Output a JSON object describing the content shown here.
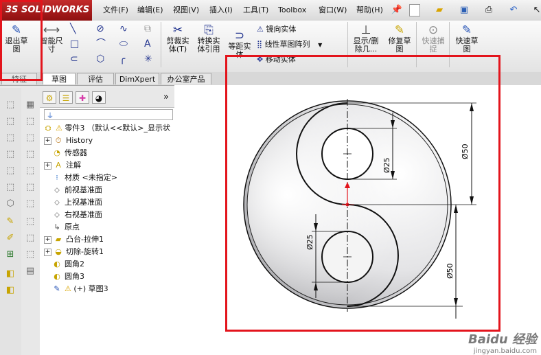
{
  "app": {
    "logo_text": "SOLIDWORKS",
    "logo_mark": "3S"
  },
  "menu": [
    "文件(F)",
    "编辑(E)",
    "视图(V)",
    "插入(I)",
    "工具(T)",
    "Toolbox",
    "窗口(W)",
    "帮助(H)"
  ],
  "quick_access_icons": [
    "pin-icon",
    "new-document-icon",
    "open-folder-icon",
    "save-icon",
    "print-icon",
    "undo-icon",
    "select-icon"
  ],
  "commands": {
    "exit_sketch": "退出草\n图",
    "smart_dimension": "智能尺\n寸",
    "trim_entities": "剪裁实\n体(T)",
    "convert_entities": "转换实\n体引用",
    "offset_entities": "等距实\n体",
    "mirror_entities": "镜向实体",
    "linear_pattern": "线性草图阵列",
    "move_entities": "移动实体",
    "display_delete_relations": "显示/删\n除几...",
    "repair_sketch": "修复草\n图",
    "quick_snap": "快速捕\n捉",
    "rapid_sketch": "快速草\n图",
    "features_tab_partial": "特征"
  },
  "tabs": [
    {
      "label": "草图",
      "active": true
    },
    {
      "label": "评估",
      "active": false
    },
    {
      "label": "DimXpert",
      "active": false
    },
    {
      "label": "办公室产品",
      "active": false
    }
  ],
  "feature_tree": {
    "root": "零件3 （默认<<默认>_显示状",
    "items": [
      {
        "label": "History",
        "icon": "history-icon",
        "expandable": true
      },
      {
        "label": "传感器",
        "icon": "sensor-icon",
        "expandable": false
      },
      {
        "label": "注解",
        "icon": "annotation-icon",
        "expandable": true
      },
      {
        "label": "材质 <未指定>",
        "icon": "material-icon",
        "expandable": false
      },
      {
        "label": "前视基准面",
        "icon": "plane-icon",
        "expandable": false
      },
      {
        "label": "上视基准面",
        "icon": "plane-icon",
        "expandable": false
      },
      {
        "label": "右视基准面",
        "icon": "plane-icon",
        "expandable": false
      },
      {
        "label": "原点",
        "icon": "origin-icon",
        "expandable": false
      },
      {
        "label": "凸台-拉伸1",
        "icon": "extrude-icon",
        "expandable": true
      },
      {
        "label": "切除-旋转1",
        "icon": "revolve-cut-icon",
        "expandable": true
      },
      {
        "label": "圆角2",
        "icon": "fillet-icon",
        "expandable": false
      },
      {
        "label": "圆角3",
        "icon": "fillet-icon",
        "expandable": false
      },
      {
        "label": "(+) 草图3",
        "icon": "sketch-icon",
        "expandable": false,
        "warning": true
      }
    ]
  },
  "sketch": {
    "dim_large_top": "Ø50",
    "dim_small_top": "Ø25",
    "dim_small_bottom": "Ø25",
    "dim_large_bottom": "Ø50"
  },
  "watermark": {
    "brand": "Baidu 经验",
    "url": "jingyan.baidu.com"
  },
  "colors": {
    "highlight": "#e3141c",
    "logo_red": "#b31d1d"
  }
}
